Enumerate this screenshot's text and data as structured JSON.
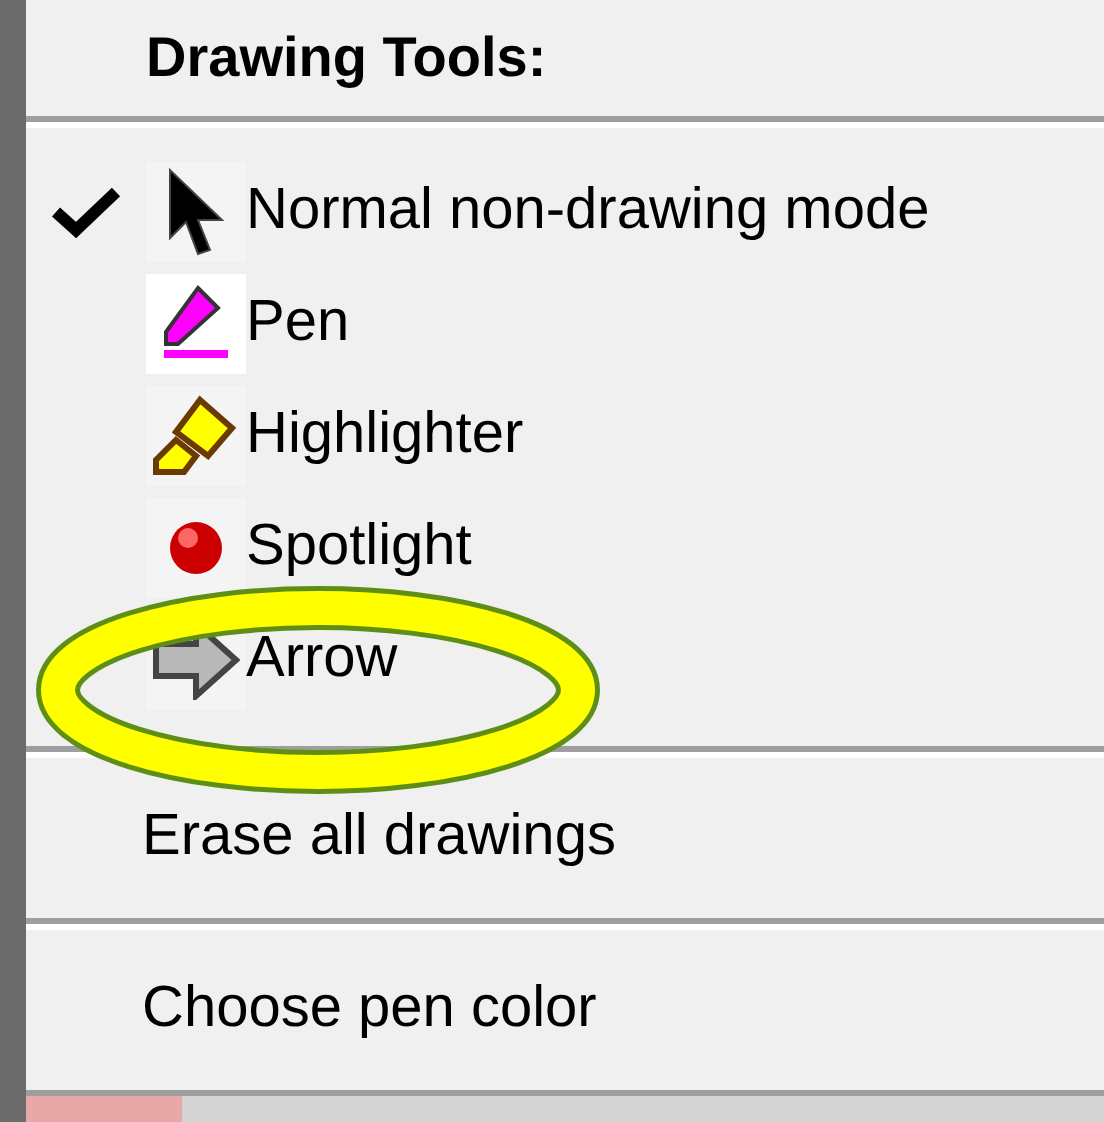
{
  "menu": {
    "title": "Drawing Tools:",
    "tools": [
      {
        "label": "Normal non-drawing mode",
        "checked": true
      },
      {
        "label": "Pen",
        "checked": false
      },
      {
        "label": "Highlighter",
        "checked": false
      },
      {
        "label": "Spotlight",
        "checked": false
      },
      {
        "label": "Arrow",
        "checked": false
      }
    ],
    "actions": [
      {
        "label": "Erase all drawings"
      },
      {
        "label": "Choose pen color"
      }
    ]
  }
}
